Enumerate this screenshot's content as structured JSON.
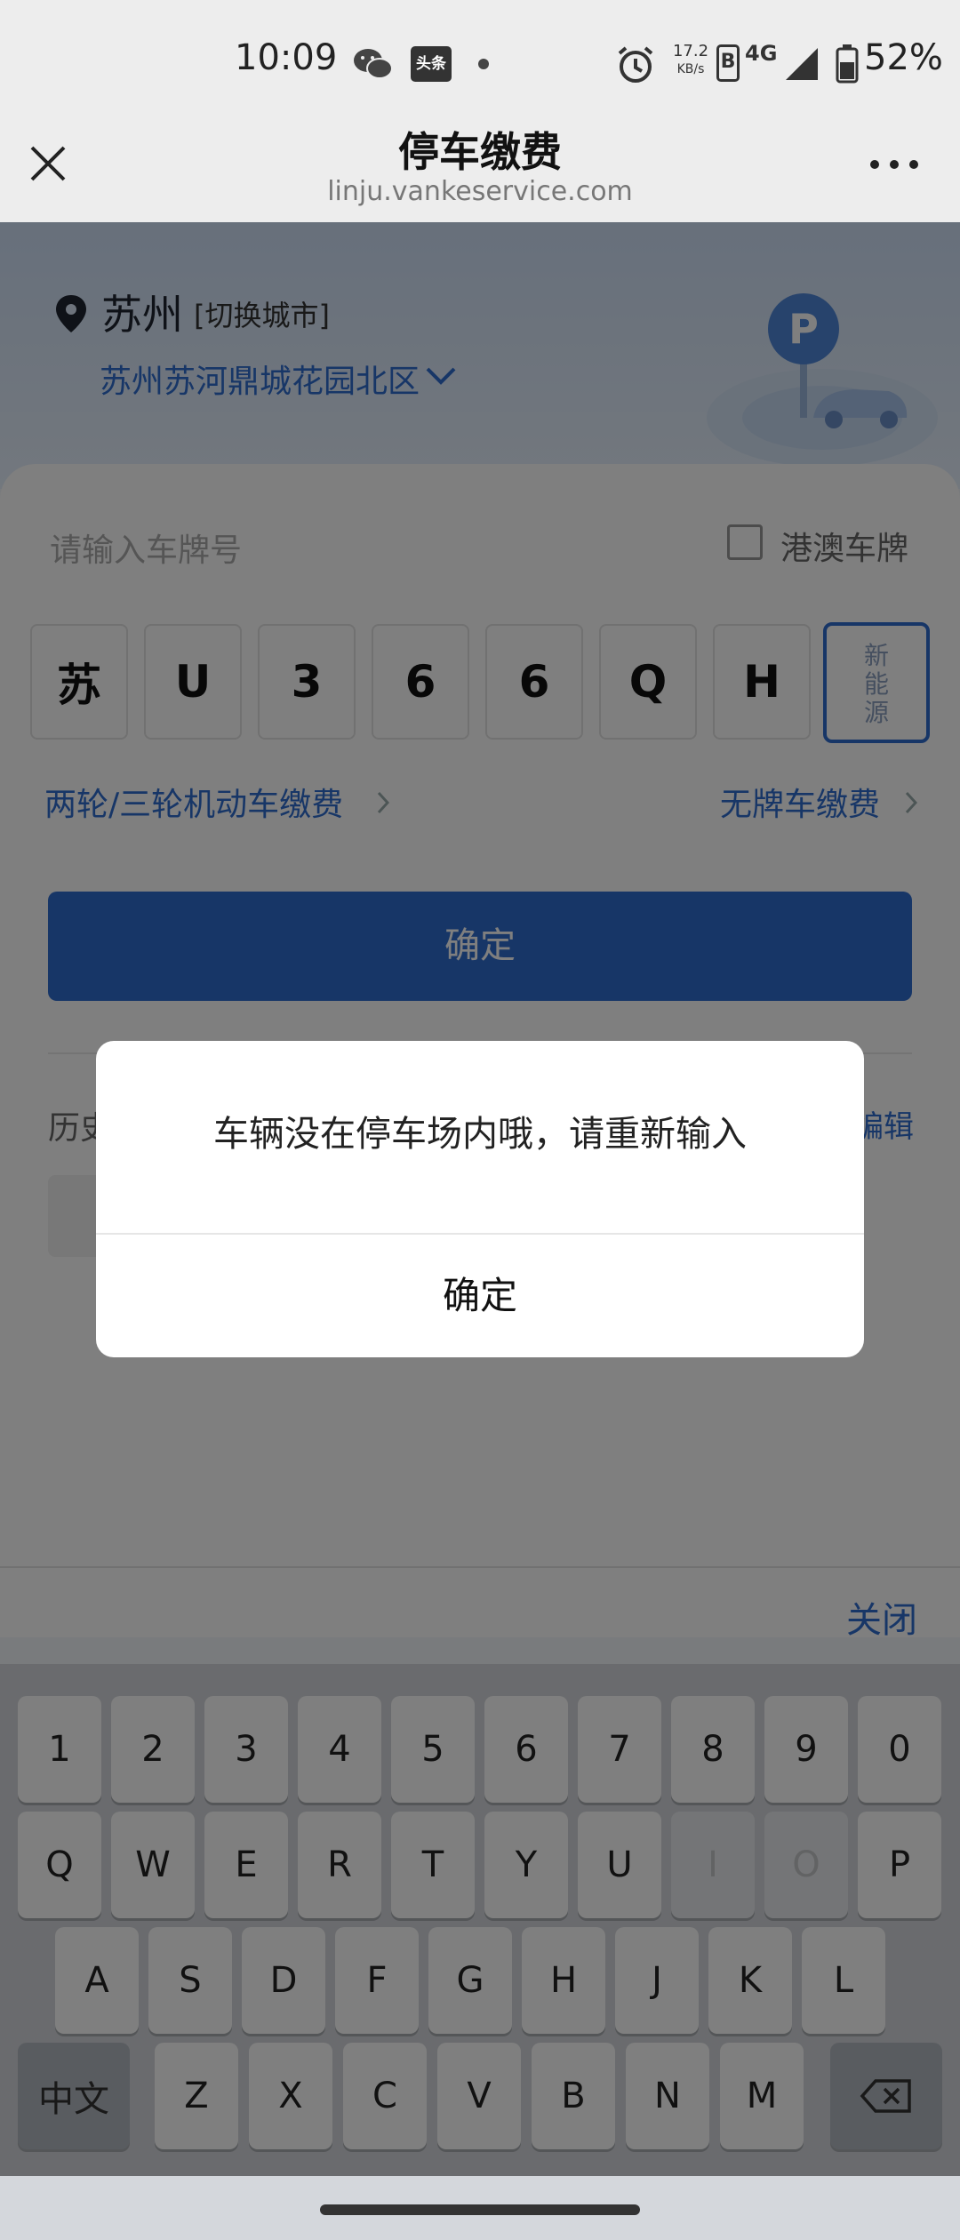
{
  "status_bar": {
    "time": "10:09",
    "toutiao_badge": "头条",
    "net_speed_value": "17.2",
    "net_speed_unit": "KB/s",
    "b_badge": "B",
    "network": "4G",
    "battery": "52%"
  },
  "nav": {
    "title": "停车缴费",
    "url": "linju.vankeservice.com"
  },
  "location": {
    "city": "苏州",
    "switch_label": "[切换城市]",
    "community": "苏州苏河鼎城花园北区"
  },
  "plate_input": {
    "placeholder": "请输入车牌号",
    "hk_macau_label": "港澳车牌",
    "hk_macau_checked": false,
    "chars": [
      "苏",
      "U",
      "3",
      "6",
      "6",
      "Q",
      "H"
    ],
    "new_energy_label": [
      "新",
      "能",
      "源"
    ]
  },
  "links": {
    "two_three_wheel": "两轮/三轮机动车缴费",
    "no_plate": "无牌车缴费"
  },
  "confirm_button": "确定",
  "history": {
    "label": "历史",
    "edit": "编辑"
  },
  "keyboard": {
    "close_label": "关闭",
    "row1": [
      "1",
      "2",
      "3",
      "4",
      "5",
      "6",
      "7",
      "8",
      "9",
      "0"
    ],
    "row2": [
      "Q",
      "W",
      "E",
      "R",
      "T",
      "Y",
      "U",
      "I",
      "O",
      "P"
    ],
    "row2_disabled": [
      "I",
      "O"
    ],
    "row3": [
      "A",
      "S",
      "D",
      "F",
      "G",
      "H",
      "J",
      "K",
      "L"
    ],
    "row4": [
      "Z",
      "X",
      "C",
      "V",
      "B",
      "N",
      "M"
    ],
    "chinese_key": "中文",
    "delete_icon": "backspace-icon"
  },
  "dialog": {
    "message": "车辆没在停车场内哦，请重新输入",
    "ok": "确定"
  },
  "colors": {
    "accent": "#2f6ccf",
    "overlay": "rgba(0,0,0,0.5)"
  }
}
